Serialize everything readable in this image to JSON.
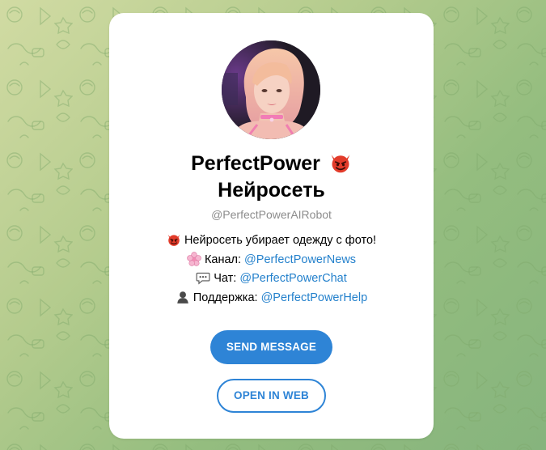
{
  "profile": {
    "name_line1": "PerfectPower",
    "name_line2": "Нейросеть",
    "username": "@PerfectPowerAIRobot",
    "avatar_alt": "PerfectPower"
  },
  "description": {
    "line1": "Нейросеть убирает одежду с фото!",
    "channel_label": "Канал: ",
    "channel_link": "@PerfectPowerNews",
    "chat_label": "Чат: ",
    "chat_link": "@PerfectPowerChat",
    "support_label": "Поддержка: ",
    "support_link": "@PerfectPowerHelp"
  },
  "buttons": {
    "send_message": "SEND MESSAGE",
    "open_in_web": "OPEN IN WEB"
  },
  "icons": {
    "title_emoji": "devil-emoji-icon",
    "line1_emoji": "devil-emoji-icon",
    "channel_emoji": "cherry-blossom-icon",
    "chat_emoji": "speech-bubble-icon",
    "support_emoji": "silhouette-icon"
  },
  "colors": {
    "accent": "#2e84d6",
    "link": "#2481cc",
    "username": "#8c8c8c",
    "devil": "#e23b2a"
  }
}
